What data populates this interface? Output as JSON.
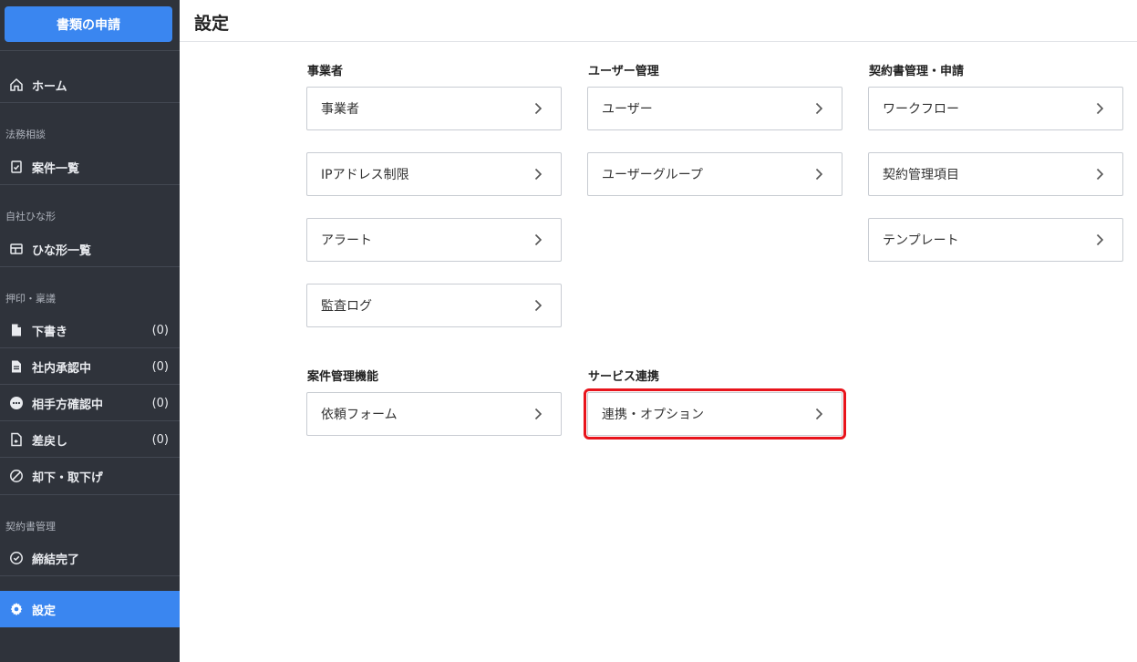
{
  "sidebar": {
    "apply_button": "書類の申請",
    "home": "ホーム",
    "sections": {
      "legal": "法務相談",
      "templates": "自社ひな形",
      "approval": "押印・稟議",
      "contract": "契約書管理"
    },
    "items": {
      "cases": "案件一覧",
      "template_list": "ひな形一覧",
      "drafts": {
        "label": "下書き",
        "count": "(0)"
      },
      "internal_approval": {
        "label": "社内承認中",
        "count": "(0)"
      },
      "counterparty_review": {
        "label": "相手方確認中",
        "count": "(0)"
      },
      "returned": {
        "label": "差戻し",
        "count": "(0)"
      },
      "rejected": "却下・取下げ",
      "concluded": "締結完了",
      "settings": "設定"
    }
  },
  "header": {
    "title": "設定"
  },
  "groups": {
    "business": {
      "title": "事業者",
      "items": [
        "事業者",
        "IPアドレス制限",
        "アラート",
        "監査ログ"
      ]
    },
    "user_mgmt": {
      "title": "ユーザー管理",
      "items": [
        "ユーザー",
        "ユーザーグループ"
      ]
    },
    "contract_mgmt": {
      "title": "契約書管理・申請",
      "items": [
        "ワークフロー",
        "契約管理項目",
        "テンプレート"
      ]
    },
    "case_mgmt": {
      "title": "案件管理機能",
      "items": [
        "依頼フォーム"
      ]
    },
    "service": {
      "title": "サービス連携",
      "items": [
        "連携・オプション"
      ]
    }
  },
  "colors": {
    "sidebar_bg": "#2f333b",
    "accent": "#3a86f0",
    "highlight": "#e8141c"
  }
}
